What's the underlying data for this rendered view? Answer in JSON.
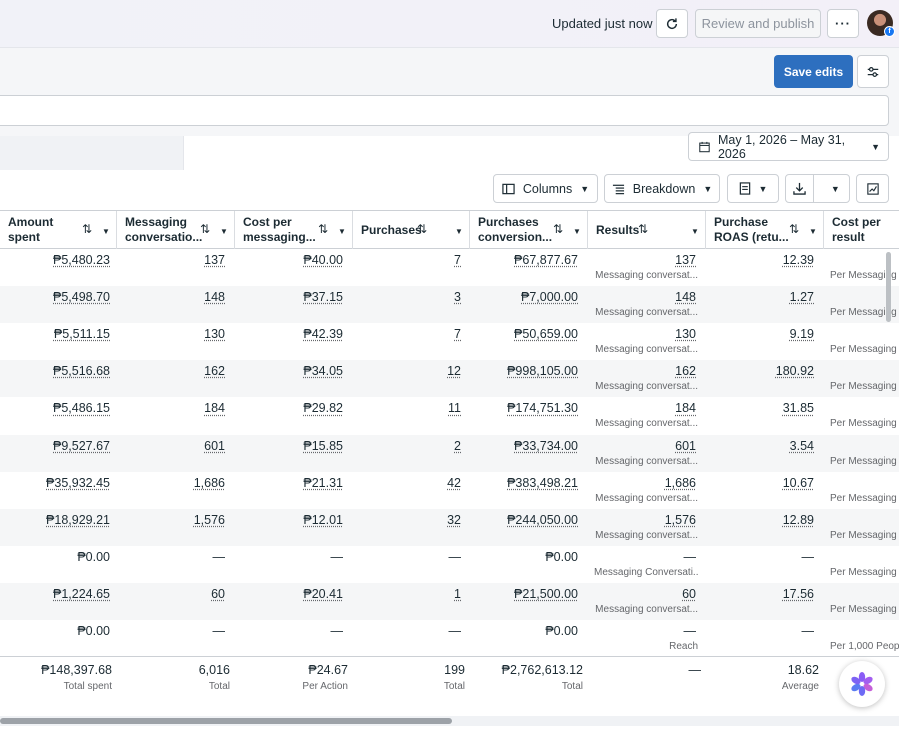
{
  "header": {
    "updated_text": "Updated just now",
    "review_label": "Review and publish",
    "more_label": "···"
  },
  "toolbar": {
    "save_label": "Save edits",
    "date_range": "May 1, 2026 – May 31, 2026",
    "columns_label": "Columns",
    "breakdown_label": "Breakdown"
  },
  "columns": [
    {
      "line1": "Amount",
      "line2": "spent"
    },
    {
      "line1": "Messaging",
      "line2": "conversatio..."
    },
    {
      "line1": "Cost per",
      "line2": "messaging..."
    },
    {
      "line1": "Purchases",
      "line2": ""
    },
    {
      "line1": "Purchases",
      "line2": "conversion..."
    },
    {
      "line1": "Results",
      "line2": ""
    },
    {
      "line1": "Purchase",
      "line2": "ROAS (retu..."
    },
    {
      "line1": "Cost per",
      "line2": "result"
    }
  ],
  "rows": [
    {
      "amount": "₱5,480.23",
      "msg": "137",
      "cost_msg": "₱40.00",
      "purchases": "7",
      "pconv": "₱67,877.67",
      "results": "137",
      "results_sub": "Messaging conversat...",
      "roas": "12.39",
      "cpr_sub": "Per Messaging"
    },
    {
      "amount": "₱5,498.70",
      "msg": "148",
      "cost_msg": "₱37.15",
      "purchases": "3",
      "pconv": "₱7,000.00",
      "results": "148",
      "results_sub": "Messaging conversat...",
      "roas": "1.27",
      "cpr_sub": "Per Messaging"
    },
    {
      "amount": "₱5,511.15",
      "msg": "130",
      "cost_msg": "₱42.39",
      "purchases": "7",
      "pconv": "₱50,659.00",
      "results": "130",
      "results_sub": "Messaging conversat...",
      "roas": "9.19",
      "cpr_sub": "Per Messaging"
    },
    {
      "amount": "₱5,516.68",
      "msg": "162",
      "cost_msg": "₱34.05",
      "purchases": "12",
      "pconv": "₱998,105.00",
      "results": "162",
      "results_sub": "Messaging conversat...",
      "roas": "180.92",
      "cpr_sub": "Per Messaging"
    },
    {
      "amount": "₱5,486.15",
      "msg": "184",
      "cost_msg": "₱29.82",
      "purchases": "11",
      "pconv": "₱174,751.30",
      "results": "184",
      "results_sub": "Messaging conversat...",
      "roas": "31.85",
      "cpr_sub": "Per Messaging"
    },
    {
      "amount": "₱9,527.67",
      "msg": "601",
      "cost_msg": "₱15.85",
      "purchases": "2",
      "pconv": "₱33,734.00",
      "results": "601",
      "results_sub": "Messaging conversat...",
      "roas": "3.54",
      "cpr_sub": "Per Messaging"
    },
    {
      "amount": "₱35,932.45",
      "msg": "1,686",
      "cost_msg": "₱21.31",
      "purchases": "42",
      "pconv": "₱383,498.21",
      "results": "1,686",
      "results_sub": "Messaging conversat...",
      "roas": "10.67",
      "cpr_sub": "Per Messaging"
    },
    {
      "amount": "₱18,929.21",
      "msg": "1,576",
      "cost_msg": "₱12.01",
      "purchases": "32",
      "pconv": "₱244,050.00",
      "results": "1,576",
      "results_sub": "Messaging conversat...",
      "roas": "12.89",
      "cpr_sub": "Per Messaging"
    },
    {
      "amount": "₱0.00",
      "msg": "—",
      "cost_msg": "—",
      "purchases": "—",
      "pconv": "₱0.00",
      "results": "—",
      "results_sub": "Messaging Conversati...",
      "roas": "—",
      "cpr_sub": "Per Messaging"
    },
    {
      "amount": "₱1,224.65",
      "msg": "60",
      "cost_msg": "₱20.41",
      "purchases": "1",
      "pconv": "₱21,500.00",
      "results": "60",
      "results_sub": "Messaging conversat...",
      "roas": "17.56",
      "cpr_sub": "Per Messaging"
    },
    {
      "amount": "₱0.00",
      "msg": "—",
      "cost_msg": "—",
      "purchases": "—",
      "pconv": "₱0.00",
      "results": "—",
      "results_sub": "Reach",
      "roas": "—",
      "cpr_sub": "Per 1,000 Peop"
    }
  ],
  "totals": {
    "amount": "₱148,397.68",
    "amount_label": "Total spent",
    "msg": "6,016",
    "msg_label": "Total",
    "cost_msg": "₱24.67",
    "cost_msg_label": "Per Action",
    "purchases": "199",
    "purchases_label": "Total",
    "pconv": "₱2,762,613.12",
    "pconv_label": "Total",
    "results": "—",
    "roas": "18.62",
    "roas_label": "Average"
  }
}
